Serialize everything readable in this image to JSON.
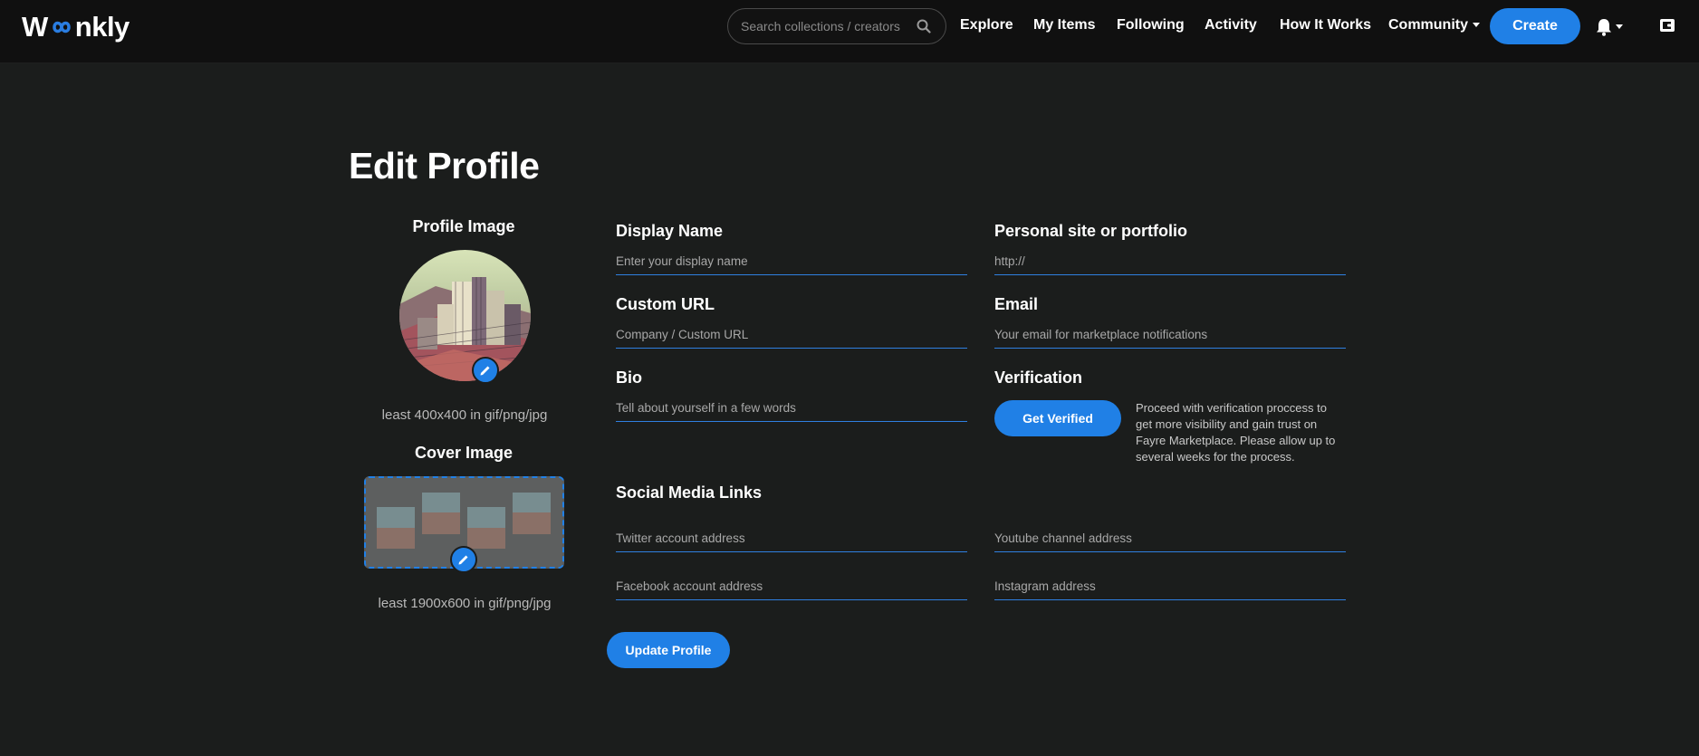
{
  "nav": {
    "logo_pre": "W",
    "logo_post": "nkly",
    "search_placeholder": "Search collections / creators",
    "links": [
      "Explore",
      "My Items",
      "Following",
      "Activity",
      "How It Works",
      "Community"
    ],
    "create_label": "Create"
  },
  "page": {
    "title": "Edit Profile"
  },
  "profile_image": {
    "heading": "Profile Image",
    "hint": "least 400x400 in gif/png/jpg"
  },
  "cover_image": {
    "heading": "Cover Image",
    "hint": "least 1900x600 in gif/png/jpg"
  },
  "form": {
    "display_name": {
      "label": "Display Name",
      "placeholder": "Enter your display name"
    },
    "personal_site": {
      "label": "Personal site or portfolio",
      "placeholder": "http://"
    },
    "custom_url": {
      "label": "Custom URL",
      "placeholder": "Company / Custom URL"
    },
    "email": {
      "label": "Email",
      "placeholder": "Your email for marketplace notifications"
    },
    "bio": {
      "label": "Bio",
      "placeholder": "Tell about yourself in a few words"
    },
    "verification": {
      "label": "Verification",
      "button": "Get Verified",
      "text": "Proceed with verification proccess to get more visibility and gain trust on Fayre Marketplace. Please allow up to several weeks for the process."
    },
    "social": {
      "heading": "Social Media Links",
      "twitter": "Twitter account address",
      "youtube": "Youtube channel address",
      "facebook": "Facebook account address",
      "instagram": "Instagram address"
    },
    "update_button": "Update Profile"
  },
  "colors": {
    "accent": "#2080e6",
    "background": "#1b1d1c",
    "nav": "#101010"
  }
}
